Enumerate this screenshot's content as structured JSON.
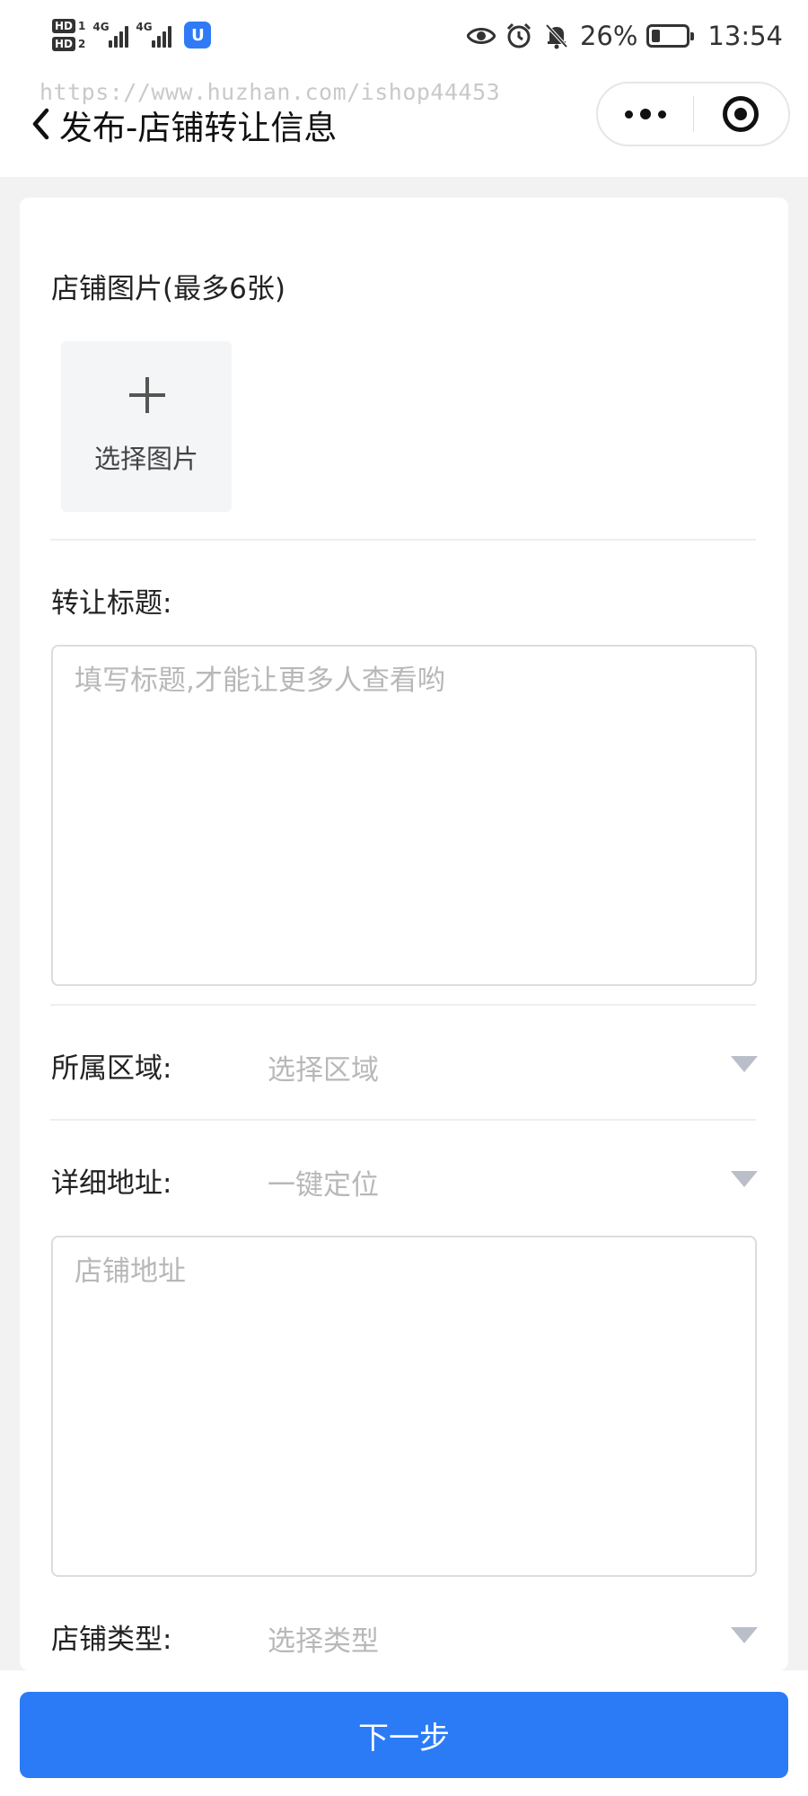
{
  "status_bar": {
    "sim1_tag": "HD",
    "sim1_num": "1",
    "sim2_tag": "HD",
    "sim2_num": "2",
    "network1": "4G",
    "network2": "4G",
    "app_badge": "U",
    "battery_text": "26%",
    "battery_level": 0.26,
    "time": "13:54"
  },
  "watermark": "https://www.huzhan.com/ishop44453",
  "nav": {
    "title": "发布-店铺转让信息"
  },
  "form": {
    "images_label": "店铺图片(最多6张)",
    "upload_label": "选择图片",
    "title_label": "转让标题:",
    "title_placeholder": "填写标题,才能让更多人查看哟",
    "region_label": "所属区域:",
    "region_value": "选择区域",
    "address_label": "详细地址:",
    "address_value": "一键定位",
    "address_placeholder": "店铺地址",
    "type_label": "店铺类型:",
    "type_value": "选择类型"
  },
  "next_button": "下一步"
}
